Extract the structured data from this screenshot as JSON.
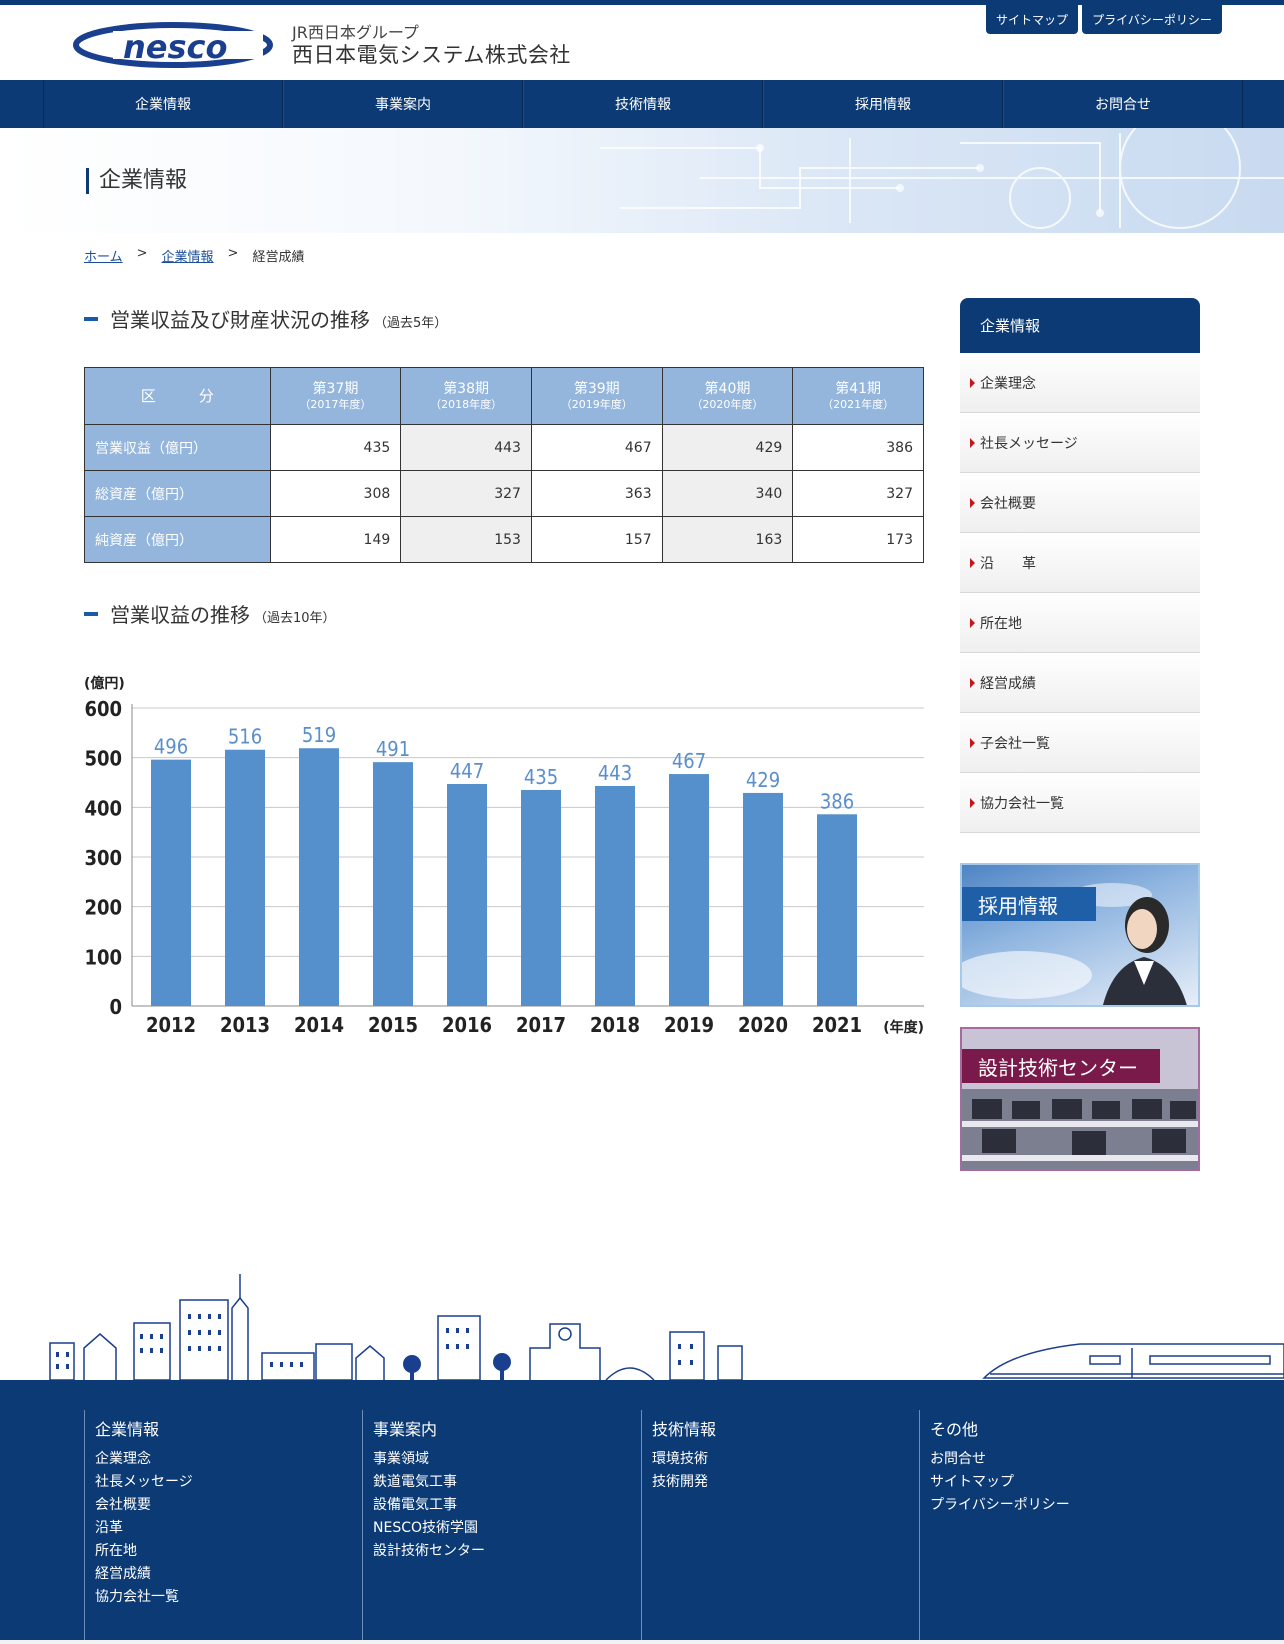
{
  "header": {
    "group_name": "JR西日本グループ",
    "company_name": "西日本電気システム株式会社",
    "logo_text": "nesco",
    "utility": {
      "sitemap": "サイトマップ",
      "privacy": "プライバシーポリシー"
    }
  },
  "gnav": [
    "企業情報",
    "事業案内",
    "技術情報",
    "採用情報",
    "お問合せ"
  ],
  "hero": {
    "title": "企業情報"
  },
  "breadcrumb": {
    "home": "ホーム",
    "sep": ">",
    "section": "企業情報",
    "current": "経営成績"
  },
  "section1": {
    "title": "営業収益及び財産状況の推移",
    "sub": "（過去5年）"
  },
  "table": {
    "header_label": "区　分",
    "columns": [
      {
        "period": "第37期",
        "year": "（2017年度）"
      },
      {
        "period": "第38期",
        "year": "（2018年度）"
      },
      {
        "period": "第39期",
        "year": "（2019年度）"
      },
      {
        "period": "第40期",
        "year": "（2020年度）"
      },
      {
        "period": "第41期",
        "year": "（2021年度）"
      }
    ],
    "rows": [
      {
        "label": "営業収益（億円）",
        "values": [
          "435",
          "443",
          "467",
          "429",
          "386"
        ]
      },
      {
        "label": "総資産（億円）",
        "values": [
          "308",
          "327",
          "363",
          "340",
          "327"
        ]
      },
      {
        "label": "純資産（億円）",
        "values": [
          "149",
          "153",
          "157",
          "163",
          "173"
        ]
      }
    ]
  },
  "section2": {
    "title": "営業収益の推移",
    "sub": "（過去10年）"
  },
  "chart_data": {
    "type": "bar",
    "categories": [
      "2012",
      "2013",
      "2014",
      "2015",
      "2016",
      "2017",
      "2018",
      "2019",
      "2020",
      "2021"
    ],
    "values": [
      496,
      516,
      519,
      491,
      447,
      435,
      443,
      467,
      429,
      386
    ],
    "title": "",
    "xlabel": "(年度)",
    "ylabel": "(億円)",
    "ylim": [
      0,
      600
    ],
    "yticks": [
      0,
      100,
      200,
      300,
      400,
      500,
      600
    ],
    "bar_color": "#5590cc",
    "label_color": "#5b8fcb",
    "grid": true
  },
  "sidebar": {
    "title": "企業情報",
    "items": [
      "企業理念",
      "社長メッセージ",
      "会社概要",
      "沿　　革",
      "所在地",
      "経営成績",
      "子会社一覧",
      "協力会社一覧"
    ],
    "banner_recruit": "採用情報",
    "banner_design": "設計技術センター"
  },
  "footer": {
    "columns": [
      {
        "title": "企業情報",
        "links": [
          "企業理念",
          "社長メッセージ",
          "会社概要",
          "沿革",
          "所在地",
          "経営成績",
          "協力会社一覧"
        ]
      },
      {
        "title": "事業案内",
        "links": [
          "事業領域",
          "鉄道電気工事",
          "設備電気工事",
          "NESCO技術学園",
          "設計技術センター"
        ]
      },
      {
        "title": "技術情報",
        "links": [
          "環境技術",
          "技術開発"
        ]
      },
      {
        "title": "その他",
        "links": [
          "お問合せ",
          "サイトマップ",
          "プライバシーポリシー"
        ]
      }
    ]
  },
  "colors": {
    "primary": "#0b3a75",
    "accent": "#c4161c",
    "table_head": "#94b6dc"
  }
}
